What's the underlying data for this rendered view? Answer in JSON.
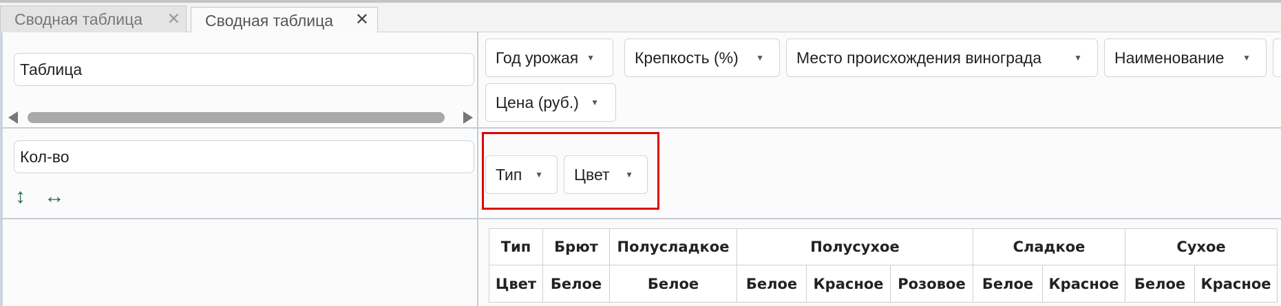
{
  "tabs": [
    {
      "label": "Сводная таблица",
      "close": "✕"
    },
    {
      "label": "Сводная таблица",
      "close": "✕"
    }
  ],
  "left_panel": {
    "renderer_value": "Таблица",
    "aggregator_value": "Кол-во",
    "row_sort_icon": "↕",
    "col_sort_icon": "↔"
  },
  "unused_attributes": [
    {
      "label": "Год урожая",
      "caret": "▼"
    },
    {
      "label": "Крепкость (%)",
      "caret": "▼"
    },
    {
      "label": "Место происхождения винограда",
      "caret": "▼"
    },
    {
      "label": "Наименование",
      "caret": "▼"
    },
    {
      "label": "Цена (руб.)",
      "caret": "▼"
    }
  ],
  "column_attributes": [
    {
      "label": "Тип",
      "caret": "▼"
    },
    {
      "label": "Цвет",
      "caret": "▼"
    }
  ],
  "pivot_table": {
    "row1_label": "Тип",
    "row2_label": "Цвет",
    "groups": [
      {
        "name": "Брют",
        "colors": [
          "Белое"
        ]
      },
      {
        "name": "Полусладкое",
        "colors": [
          "Белое"
        ]
      },
      {
        "name": "Полусухое",
        "colors": [
          "Белое",
          "Красное",
          "Розовое"
        ]
      },
      {
        "name": "Сладкое",
        "colors": [
          "Белое",
          "Красное"
        ]
      },
      {
        "name": "Сухое",
        "colors": [
          "Белое",
          "Красное"
        ]
      }
    ]
  },
  "colors": {
    "highlight": "#e00000",
    "icon_green": "#2e6b4c",
    "separator": "#c3ccd8"
  }
}
